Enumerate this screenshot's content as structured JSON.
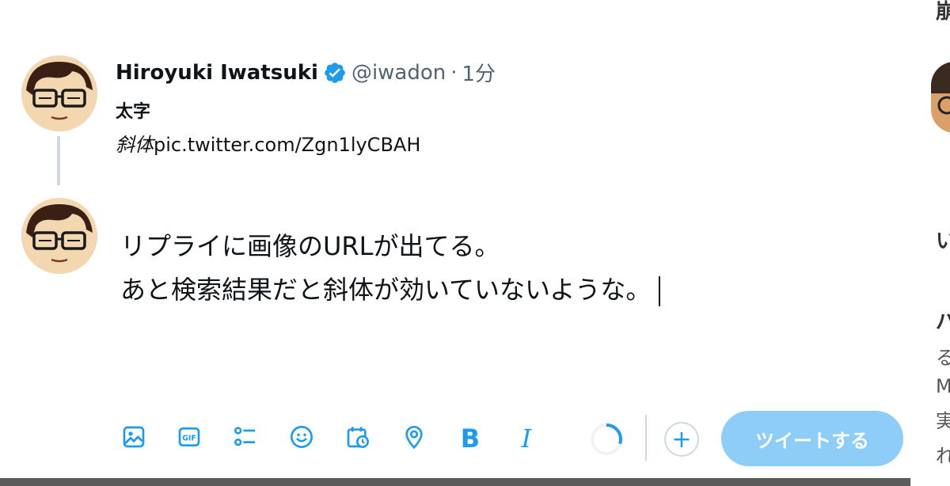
{
  "background": {
    "fragments": [
      "崩",
      "い",
      "パ",
      "る",
      "M",
      "実施",
      "れ"
    ]
  },
  "tweet": {
    "author_name": "Hiroyuki Iwatsuki",
    "handle": "@iwadon",
    "separator": "·",
    "time": "1分",
    "bold_text": "太字",
    "italic_word": "斜体",
    "link_text": "pic.twitter.com/Zgn1lyCBAH"
  },
  "reply": {
    "line1": "リプライに画像のURLが出てる。",
    "line2": "あと検索結果だと斜体が効いていないような。"
  },
  "toolbar": {
    "bold_label": "B",
    "italic_label": "I",
    "add_label": "+",
    "tweet_label": "ツイートする",
    "progress_fraction": 0.3,
    "icons": [
      "image-icon",
      "gif-icon",
      "poll-icon",
      "emoji-icon",
      "schedule-icon",
      "location-icon",
      "bold-icon",
      "italic-icon"
    ]
  },
  "colors": {
    "accent": "#1d9bf0",
    "tweet_button": "#8ecdf8",
    "text": "#0f1419",
    "secondary_text": "#536471"
  }
}
